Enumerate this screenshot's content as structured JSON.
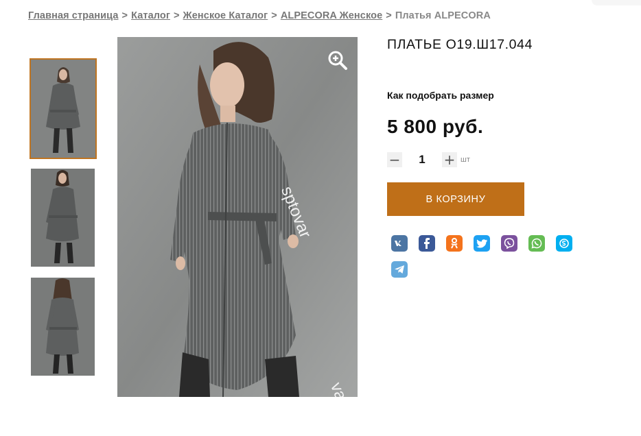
{
  "breadcrumb": {
    "items": [
      "Главная страница",
      "Каталог",
      "Женское Каталог",
      "ALPECORA Женское"
    ],
    "separator": ">",
    "current": "Платья ALPECORA"
  },
  "product": {
    "title": "ПЛАТЬЕ О19.Ш17.044",
    "size_link": "Как подобрать размер",
    "price": "5 800 руб.",
    "quantity": "1",
    "unit": "шт",
    "minus": "−",
    "plus": "+",
    "add_to_cart": "В КОРЗИНУ"
  },
  "gallery": {
    "watermark": "sptovar",
    "watermark_second": "var",
    "zoom_icon": "zoom-in-icon",
    "thumbnails": 3,
    "selected_thumbnail": 1
  },
  "share": {
    "networks": [
      {
        "name": "vk-icon",
        "glyph": "vk",
        "color": "#4c75a3"
      },
      {
        "name": "facebook-icon",
        "glyph": "f",
        "color": "#3b5998"
      },
      {
        "name": "odnoklassniki-icon",
        "glyph": "ok",
        "color": "#f4731c"
      },
      {
        "name": "twitter-icon",
        "glyph": "tw",
        "color": "#1da1f2"
      },
      {
        "name": "viber-icon",
        "glyph": "vb",
        "color": "#7b519d"
      },
      {
        "name": "whatsapp-icon",
        "glyph": "wa",
        "color": "#65bc54"
      },
      {
        "name": "skype-icon",
        "glyph": "S",
        "color": "#00aff0"
      },
      {
        "name": "telegram-icon",
        "glyph": "tg",
        "color": "#64a9dc"
      }
    ]
  },
  "colors": {
    "accent": "#bf6f18",
    "thumb_border": "#bf7420",
    "text": "#111111",
    "breadcrumb": "#777777"
  }
}
